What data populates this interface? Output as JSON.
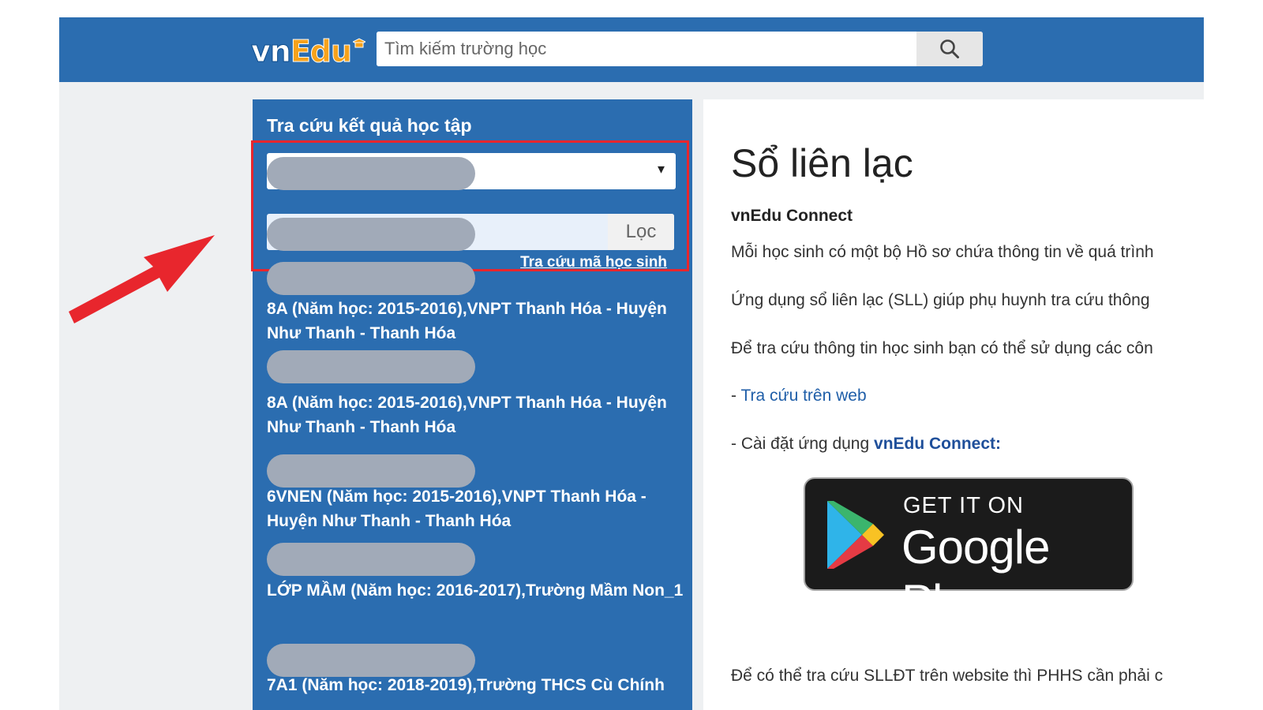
{
  "header": {
    "logo_vn": "vn",
    "logo_edu": "Edu",
    "search_placeholder": "Tìm kiếm trường học"
  },
  "left_panel": {
    "title": "Tra cứu kết quả học tập",
    "filter_button": "Lọc",
    "lookup_link": "Tra cứu mã học sinh",
    "students": [
      "8A (Năm học: 2015-2016),VNPT Thanh Hóa - Huyện Như Thanh - Thanh Hóa",
      "8A (Năm học: 2015-2016),VNPT Thanh Hóa - Huyện Như Thanh - Thanh Hóa",
      "6VNEN (Năm học: 2015-2016),VNPT Thanh Hóa - Huyện Như Thanh - Thanh Hóa",
      "LỚP MẦM (Năm học: 2016-2017),Trường Mầm Non_1",
      "7A1 (Năm học: 2018-2019),Trường THCS Cù Chính"
    ]
  },
  "right_panel": {
    "title": "Sổ liên lạc",
    "subtitle": "vnEdu Connect",
    "p1": "Mỗi học sinh có một bộ Hồ sơ chứa thông tin về quá trình",
    "p2": "Ứng dụng sổ liên lạc (SLL) giúp phụ huynh tra cứu thông",
    "p3": "Để tra cứu thông tin học sinh bạn có thể sử dụng các côn",
    "p4_prefix": "- ",
    "p4_link": "Tra cứu trên web",
    "p5_prefix": "- Cài đặt ứng dụng ",
    "p5_link": "vnEdu Connect:",
    "google_play_small": "GET IT ON",
    "google_play_big": "Google Play",
    "p6": "Để có thể tra cứu SLLĐT trên website thì PHHS cần phải c"
  },
  "colors": {
    "header_blue": "#2b6db0",
    "highlight_red": "#e8262d",
    "logo_orange": "#f7a21b"
  }
}
